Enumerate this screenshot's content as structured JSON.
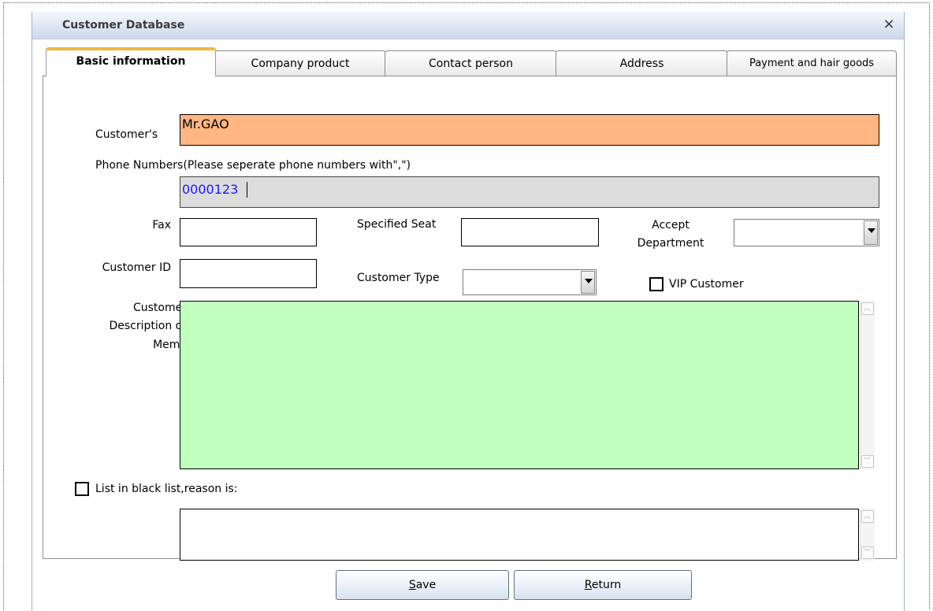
{
  "window": {
    "title": "Customer Database",
    "close_glyph": "×"
  },
  "tabs": [
    {
      "label": "Basic information",
      "active": true
    },
    {
      "label": "Company product",
      "active": false
    },
    {
      "label": "Contact person",
      "active": false
    },
    {
      "label": "Address",
      "active": false
    },
    {
      "label": "Payment and hair goods",
      "active": false
    }
  ],
  "form": {
    "customer_label": "Customer's",
    "customer_value": "Mr.GAO",
    "phone_label": "Phone Numbers(Please seperate phone numbers with\",\")",
    "phone_value": "0000123",
    "fax_label": "Fax",
    "fax_value": "",
    "specified_seat_label": "Specified Seat",
    "specified_seat_value": "",
    "accept_department_label_line1": "Accept",
    "accept_department_label_line2": "Department",
    "accept_department_value": "",
    "customer_id_label": "Customer ID",
    "customer_id_value": "",
    "customer_type_label": "Customer Type",
    "customer_type_value": "",
    "vip_label": "VIP Customer",
    "vip_checked": false,
    "description_label_line1": "Customer",
    "description_label_line2": "Description or",
    "description_label_line3": "Memo",
    "description_value": "",
    "blacklist_label": "List in black list,reason is:",
    "blacklist_checked": false,
    "blacklist_reason_value": ""
  },
  "buttons": {
    "save_mnemonic": "S",
    "save_rest": "ave",
    "return_mnemonic": "R",
    "return_rest": "eturn"
  },
  "colors": {
    "customer_field_bg": "#ffb682",
    "phone_field_bg": "#dcdcdc",
    "description_bg": "#c0ffc0",
    "phone_text": "#1a1aff",
    "active_tab_accent": "#f2b640"
  }
}
